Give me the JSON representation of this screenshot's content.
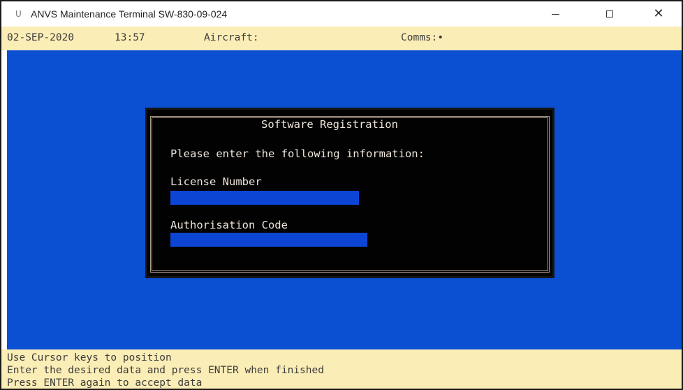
{
  "window": {
    "icon": "U",
    "title": "ANVS Maintenance Terminal SW-830-09-024",
    "controls": {
      "minimize": "minimize-icon",
      "maximize": "maximize-icon",
      "close": "close-icon"
    }
  },
  "status_bar": {
    "date": "02-SEP-2020",
    "time": "13:57",
    "aircraft": "Aircraft:",
    "comms": "Comms:•"
  },
  "dialog": {
    "title": "Software Registration",
    "prompt": "Please enter the following information:",
    "license_label": "License Number",
    "license_value": "",
    "auth_label": "Authorisation Code",
    "auth_value": ""
  },
  "help": {
    "lines": [
      "Use Cursor keys to position",
      "Enter the desired data and press ENTER when finished",
      "Press ENTER again to accept data"
    ]
  },
  "colors": {
    "terminal_background": "#0b4fd2",
    "info_bar_background": "#fbedb6",
    "dialog_background": "#020202",
    "input_field": "#0c45d4"
  }
}
